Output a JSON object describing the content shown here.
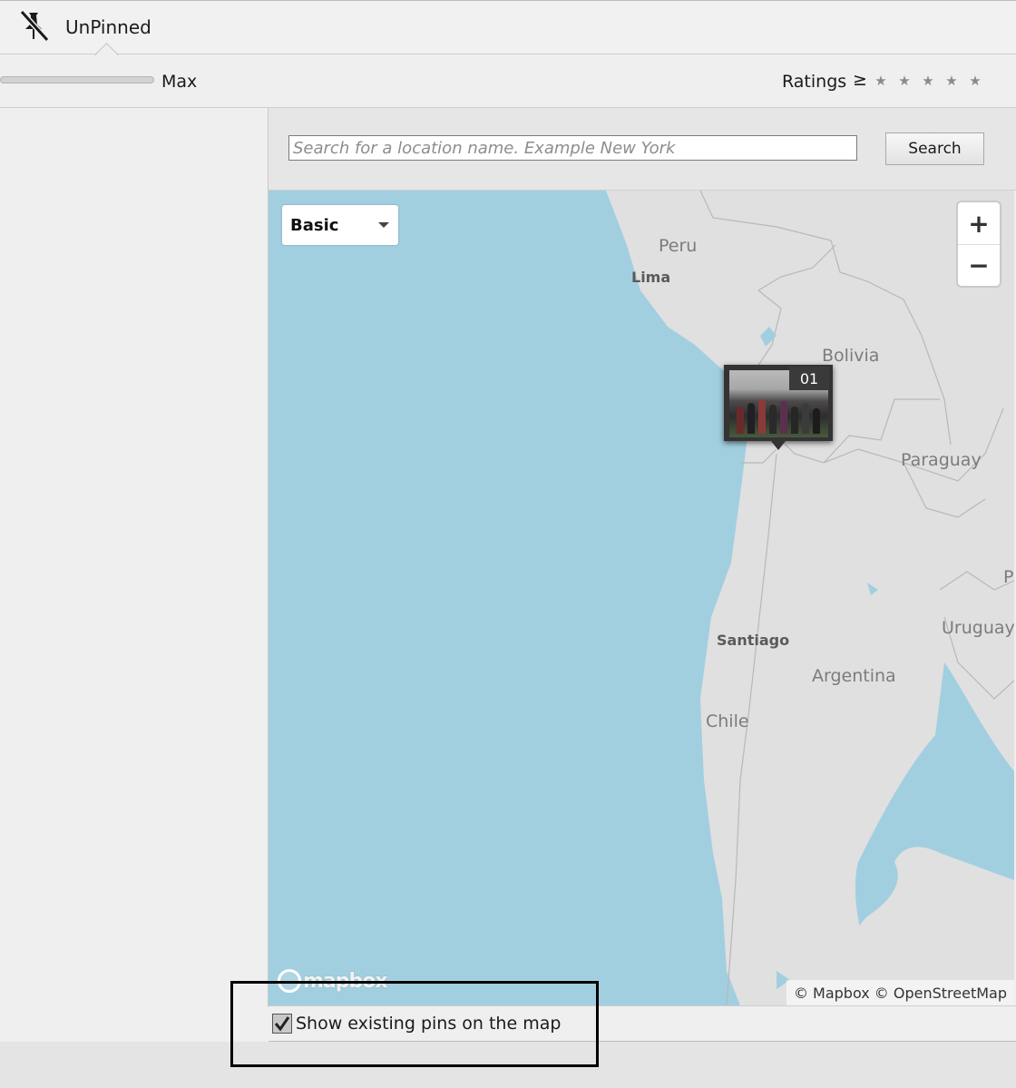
{
  "header": {
    "tab_label": "UnPinned",
    "tab_icon": "unpin-icon"
  },
  "filters": {
    "slider_max_label": "Max",
    "ratings_label": "Ratings",
    "ratings_operator": "≥",
    "stars": [
      "★",
      "★",
      "★",
      "★",
      "★"
    ]
  },
  "search": {
    "placeholder": "Search for a location name. Example New York",
    "value": "",
    "button_label": "Search"
  },
  "map": {
    "style_value": "Basic",
    "zoom_in_label": "+",
    "zoom_out_label": "−",
    "countries": [
      "Peru",
      "Bolivia",
      "Paraguay",
      "Uruguay",
      "Argentina",
      "Chile",
      "P"
    ],
    "cities": [
      "Lima",
      "Santiago"
    ],
    "photo_pin_count": "01",
    "logo_text": "mapbox",
    "attribution": "© Mapbox © OpenStreetMap",
    "colors": {
      "water": "#a2cfe0",
      "land": "#e0e0e0"
    }
  },
  "options": {
    "show_pins_label": "Show existing pins on the map",
    "show_pins_checked": true
  }
}
